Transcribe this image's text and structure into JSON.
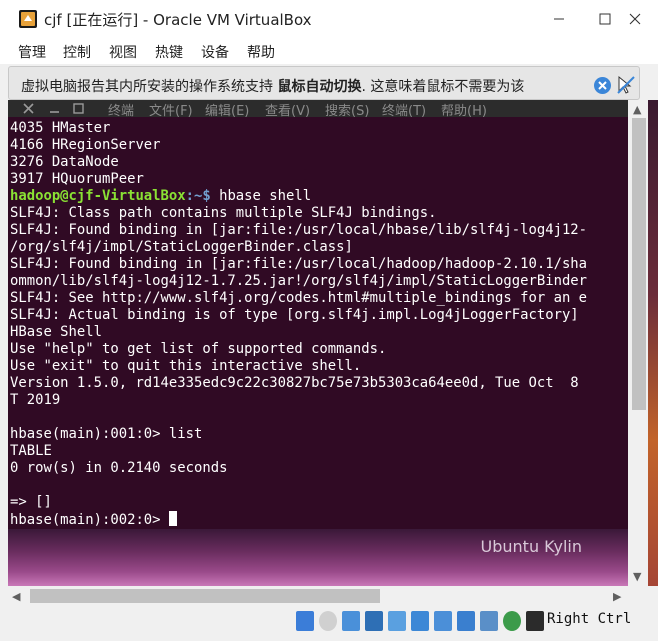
{
  "window": {
    "title": "cjf [正在运行] - Oracle VM VirtualBox"
  },
  "menubar": {
    "items": [
      "管理",
      "控制",
      "视图",
      "热键",
      "设备",
      "帮助"
    ]
  },
  "notification": {
    "text_before": "虚拟电脑报告其内所安装的操作系统支持",
    "text_bold": "鼠标自动切换",
    "text_after": ". 这意味着鼠标不需要为该"
  },
  "terminal": {
    "menu": [
      "终端",
      "文件(F)",
      "编辑(E)",
      "查看(V)",
      "搜索(S)",
      "终端(T)",
      "帮助(H)"
    ],
    "prompt_user": "hadoop@cjf-VirtualBox",
    "prompt_path": ":~$",
    "prompt_command": " hbase shell",
    "lines_before": [
      "4035 HMaster",
      "4166 HRegionServer",
      "3276 DataNode",
      "3917 HQuorumPeer"
    ],
    "lines_after": [
      "SLF4J: Class path contains multiple SLF4J bindings.",
      "SLF4J: Found binding in [jar:file:/usr/local/hbase/lib/slf4j-log4j12-",
      "/org/slf4j/impl/StaticLoggerBinder.class]",
      "SLF4J: Found binding in [jar:file:/usr/local/hadoop/hadoop-2.10.1/sha",
      "ommon/lib/slf4j-log4j12-1.7.25.jar!/org/slf4j/impl/StaticLoggerBinder",
      "SLF4J: See http://www.slf4j.org/codes.html#multiple_bindings for an e",
      "SLF4J: Actual binding is of type [org.slf4j.impl.Log4jLoggerFactory]",
      "HBase Shell",
      "Use \"help\" to get list of supported commands.",
      "Use \"exit\" to quit this interactive shell.",
      "Version 1.5.0, rd14e335edc9c22c30827bc75e73b5303ca64ee0d, Tue Oct  8",
      "T 2019",
      "",
      "hbase(main):001:0> list",
      "TABLE",
      "0 row(s) in 0.2140 seconds",
      "",
      "=> []"
    ],
    "last_prompt": "hbase(main):002:0> "
  },
  "desktop": {
    "label": "Ubuntu Kylin"
  },
  "statusbar": {
    "host_key": "Right Ctrl",
    "icons": [
      "hard-disk-icon",
      "optical-drive-icon",
      "audio-icon",
      "network-icon",
      "usb-icon",
      "shared-folder-icon",
      "display-icon",
      "video-capture-icon",
      "cpu-icon",
      "mouse-integration-icon",
      "keyboard-icon"
    ]
  },
  "colors": {
    "terminal_bg": "#300a24",
    "prompt_user": "#8ae234",
    "prompt_path": "#729fcf"
  }
}
